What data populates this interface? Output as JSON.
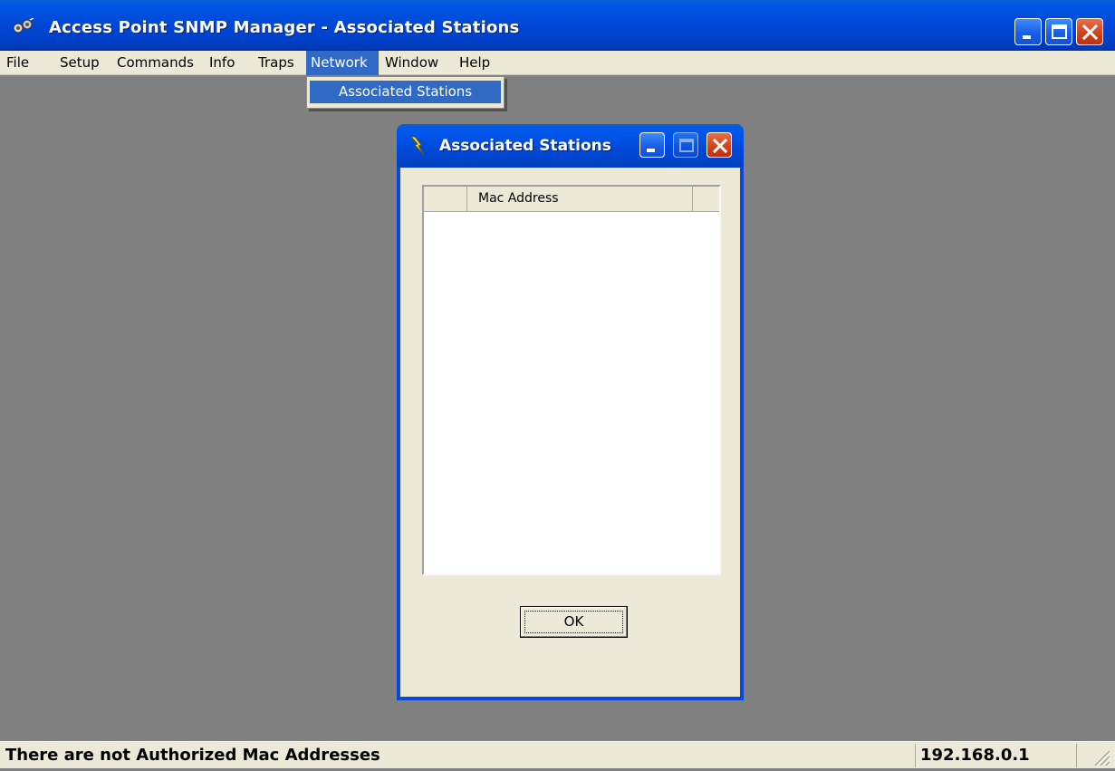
{
  "window": {
    "title": "Access Point SNMP Manager -  Associated Stations",
    "app_icon": "snmp-network-icon",
    "controls": [
      "minimize-icon",
      "maximize-icon",
      "close-icon"
    ]
  },
  "menubar": {
    "items": [
      "File",
      "Setup",
      "Commands",
      "Info",
      "Traps",
      "Network",
      "Window",
      "Help"
    ],
    "active": "Network"
  },
  "dropdown": {
    "items": [
      "Associated Stations"
    ],
    "highlighted": "Associated Stations"
  },
  "dialog": {
    "title": "Associated Stations",
    "icon": "lightning-bolt-icon",
    "list": {
      "columns": [
        "",
        "Mac Address",
        ""
      ],
      "rows": []
    },
    "ok_label": "OK"
  },
  "statusbar": {
    "message": "There are not Authorized Mac Addresses",
    "ip": "192.168.0.1"
  },
  "colors": {
    "titlebar": "#0055e5",
    "menu_highlight": "#316ac5",
    "workspace": "#808080",
    "face": "#ece9d8"
  }
}
